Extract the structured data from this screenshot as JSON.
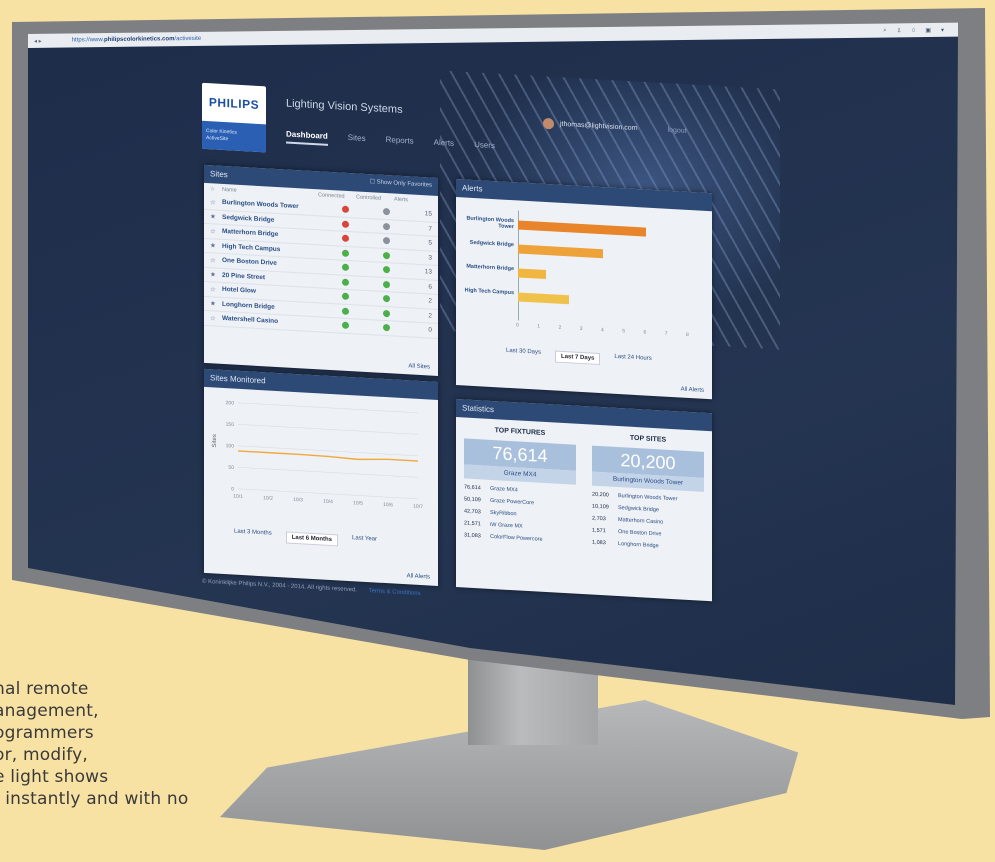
{
  "caption": {
    "lines": [
      "nal remote",
      "anagement,",
      "ogrammers",
      "or, modify,",
      "e light shows",
      ", instantly and with no"
    ]
  },
  "browser": {
    "address_prefix": "https://www.",
    "address_domain": "philipscolorkinetics.com",
    "address_path": "/activesite"
  },
  "header": {
    "brand": "PHILIPS",
    "product_line1": "Color Kinetics",
    "product_line2": "ActiveSite",
    "app_title": "Lighting Vision Systems",
    "user_email": "jthomas@lightvision.com",
    "logout": "logout"
  },
  "nav": {
    "tabs": [
      {
        "label": "Dashboard",
        "active": true
      },
      {
        "label": "Sites"
      },
      {
        "label": "Reports"
      },
      {
        "label": "Alerts"
      },
      {
        "label": "Users"
      }
    ]
  },
  "sites_panel": {
    "title": "Sites",
    "favorites_toggle": "Show Only Favorites",
    "columns": [
      "Name",
      "Connected",
      "Controlled",
      "Alerts"
    ],
    "rows": [
      {
        "name": "Burlington Woods Tower",
        "connected": "red",
        "controlled": "gray",
        "alerts": "15"
      },
      {
        "name": "Sedgwick Bridge",
        "connected": "red",
        "controlled": "gray",
        "alerts": "7"
      },
      {
        "name": "Matterhorn Bridge",
        "connected": "red",
        "controlled": "gray",
        "alerts": "5"
      },
      {
        "name": "High Tech Campus",
        "connected": "green",
        "controlled": "green",
        "alerts": "3"
      },
      {
        "name": "One Boston Drive",
        "connected": "green",
        "controlled": "green",
        "alerts": "13"
      },
      {
        "name": "20 Pine Street",
        "connected": "green",
        "controlled": "green",
        "alerts": "6"
      },
      {
        "name": "Hotel Glow",
        "connected": "green",
        "controlled": "green",
        "alerts": "2"
      },
      {
        "name": "Longhorn Bridge",
        "connected": "green",
        "controlled": "green",
        "alerts": "2"
      },
      {
        "name": "Watershell Casino",
        "connected": "green",
        "controlled": "green",
        "alerts": "0"
      }
    ],
    "all_link": "All Sites"
  },
  "alerts_panel": {
    "title": "Alerts",
    "bars": [
      {
        "label": "Burlington Woods Tower",
        "value": 6,
        "color": "#e8842a"
      },
      {
        "label": "Sedgwick Bridge",
        "value": 4,
        "color": "#eda23a"
      },
      {
        "label": "Matterhorn Bridge",
        "value": 1.3,
        "color": "#f0b63f"
      },
      {
        "label": "High Tech Campus",
        "value": 2.4,
        "color": "#f0c24c"
      }
    ],
    "x_max": 8,
    "x_ticks": [
      "0",
      "1",
      "2",
      "3",
      "4",
      "5",
      "6",
      "7",
      "8"
    ],
    "ranges": [
      "Last 30 Days",
      "Last 7 Days",
      "Last 24 Hours"
    ],
    "all_link": "All Alerts"
  },
  "monitored_panel": {
    "title": "Sites Monitored",
    "ylabel": "Sites",
    "y_ticks": [
      "200",
      "150",
      "100",
      "50",
      "0"
    ],
    "x_ticks": [
      "10/1",
      "10/2",
      "10/3",
      "10/4",
      "10/5",
      "10/6",
      "10/7"
    ],
    "values": [
      88,
      88,
      88,
      87,
      84,
      88,
      88
    ],
    "ranges": [
      "Last 3 Months",
      "Last 6 Months",
      "Last Year"
    ],
    "all_link": "All Alerts"
  },
  "stats_panel": {
    "title": "Statistics",
    "fixtures": {
      "heading": "TOP FIXTURES",
      "big": "76,614",
      "big_label": "Graze MX4",
      "rows": [
        {
          "n": "76,614",
          "name": "Graze MX4"
        },
        {
          "n": "50,109",
          "name": "Graze PowerCore"
        },
        {
          "n": "42,703",
          "name": "SkyRibbon"
        },
        {
          "n": "21,571",
          "name": "iW Graze MX"
        },
        {
          "n": "31,083",
          "name": "ColorFlow Powercore"
        }
      ]
    },
    "sites": {
      "heading": "TOP SITES",
      "big": "20,200",
      "big_label": "Burlington Woods Tower",
      "rows": [
        {
          "n": "20,200",
          "name": "Burlington Woods Tower"
        },
        {
          "n": "10,109",
          "name": "Sedgwick Bridge"
        },
        {
          "n": "2,703",
          "name": "Matterhorn Casino"
        },
        {
          "n": "1,571",
          "name": "One Boston Drive"
        },
        {
          "n": "1,083",
          "name": "Longhorn Bridge"
        }
      ]
    }
  },
  "footer": {
    "copyright": "© Koninklijke Philips N.V., 2004 - 2014. All rights reserved.",
    "terms": "Terms & Conditions"
  }
}
